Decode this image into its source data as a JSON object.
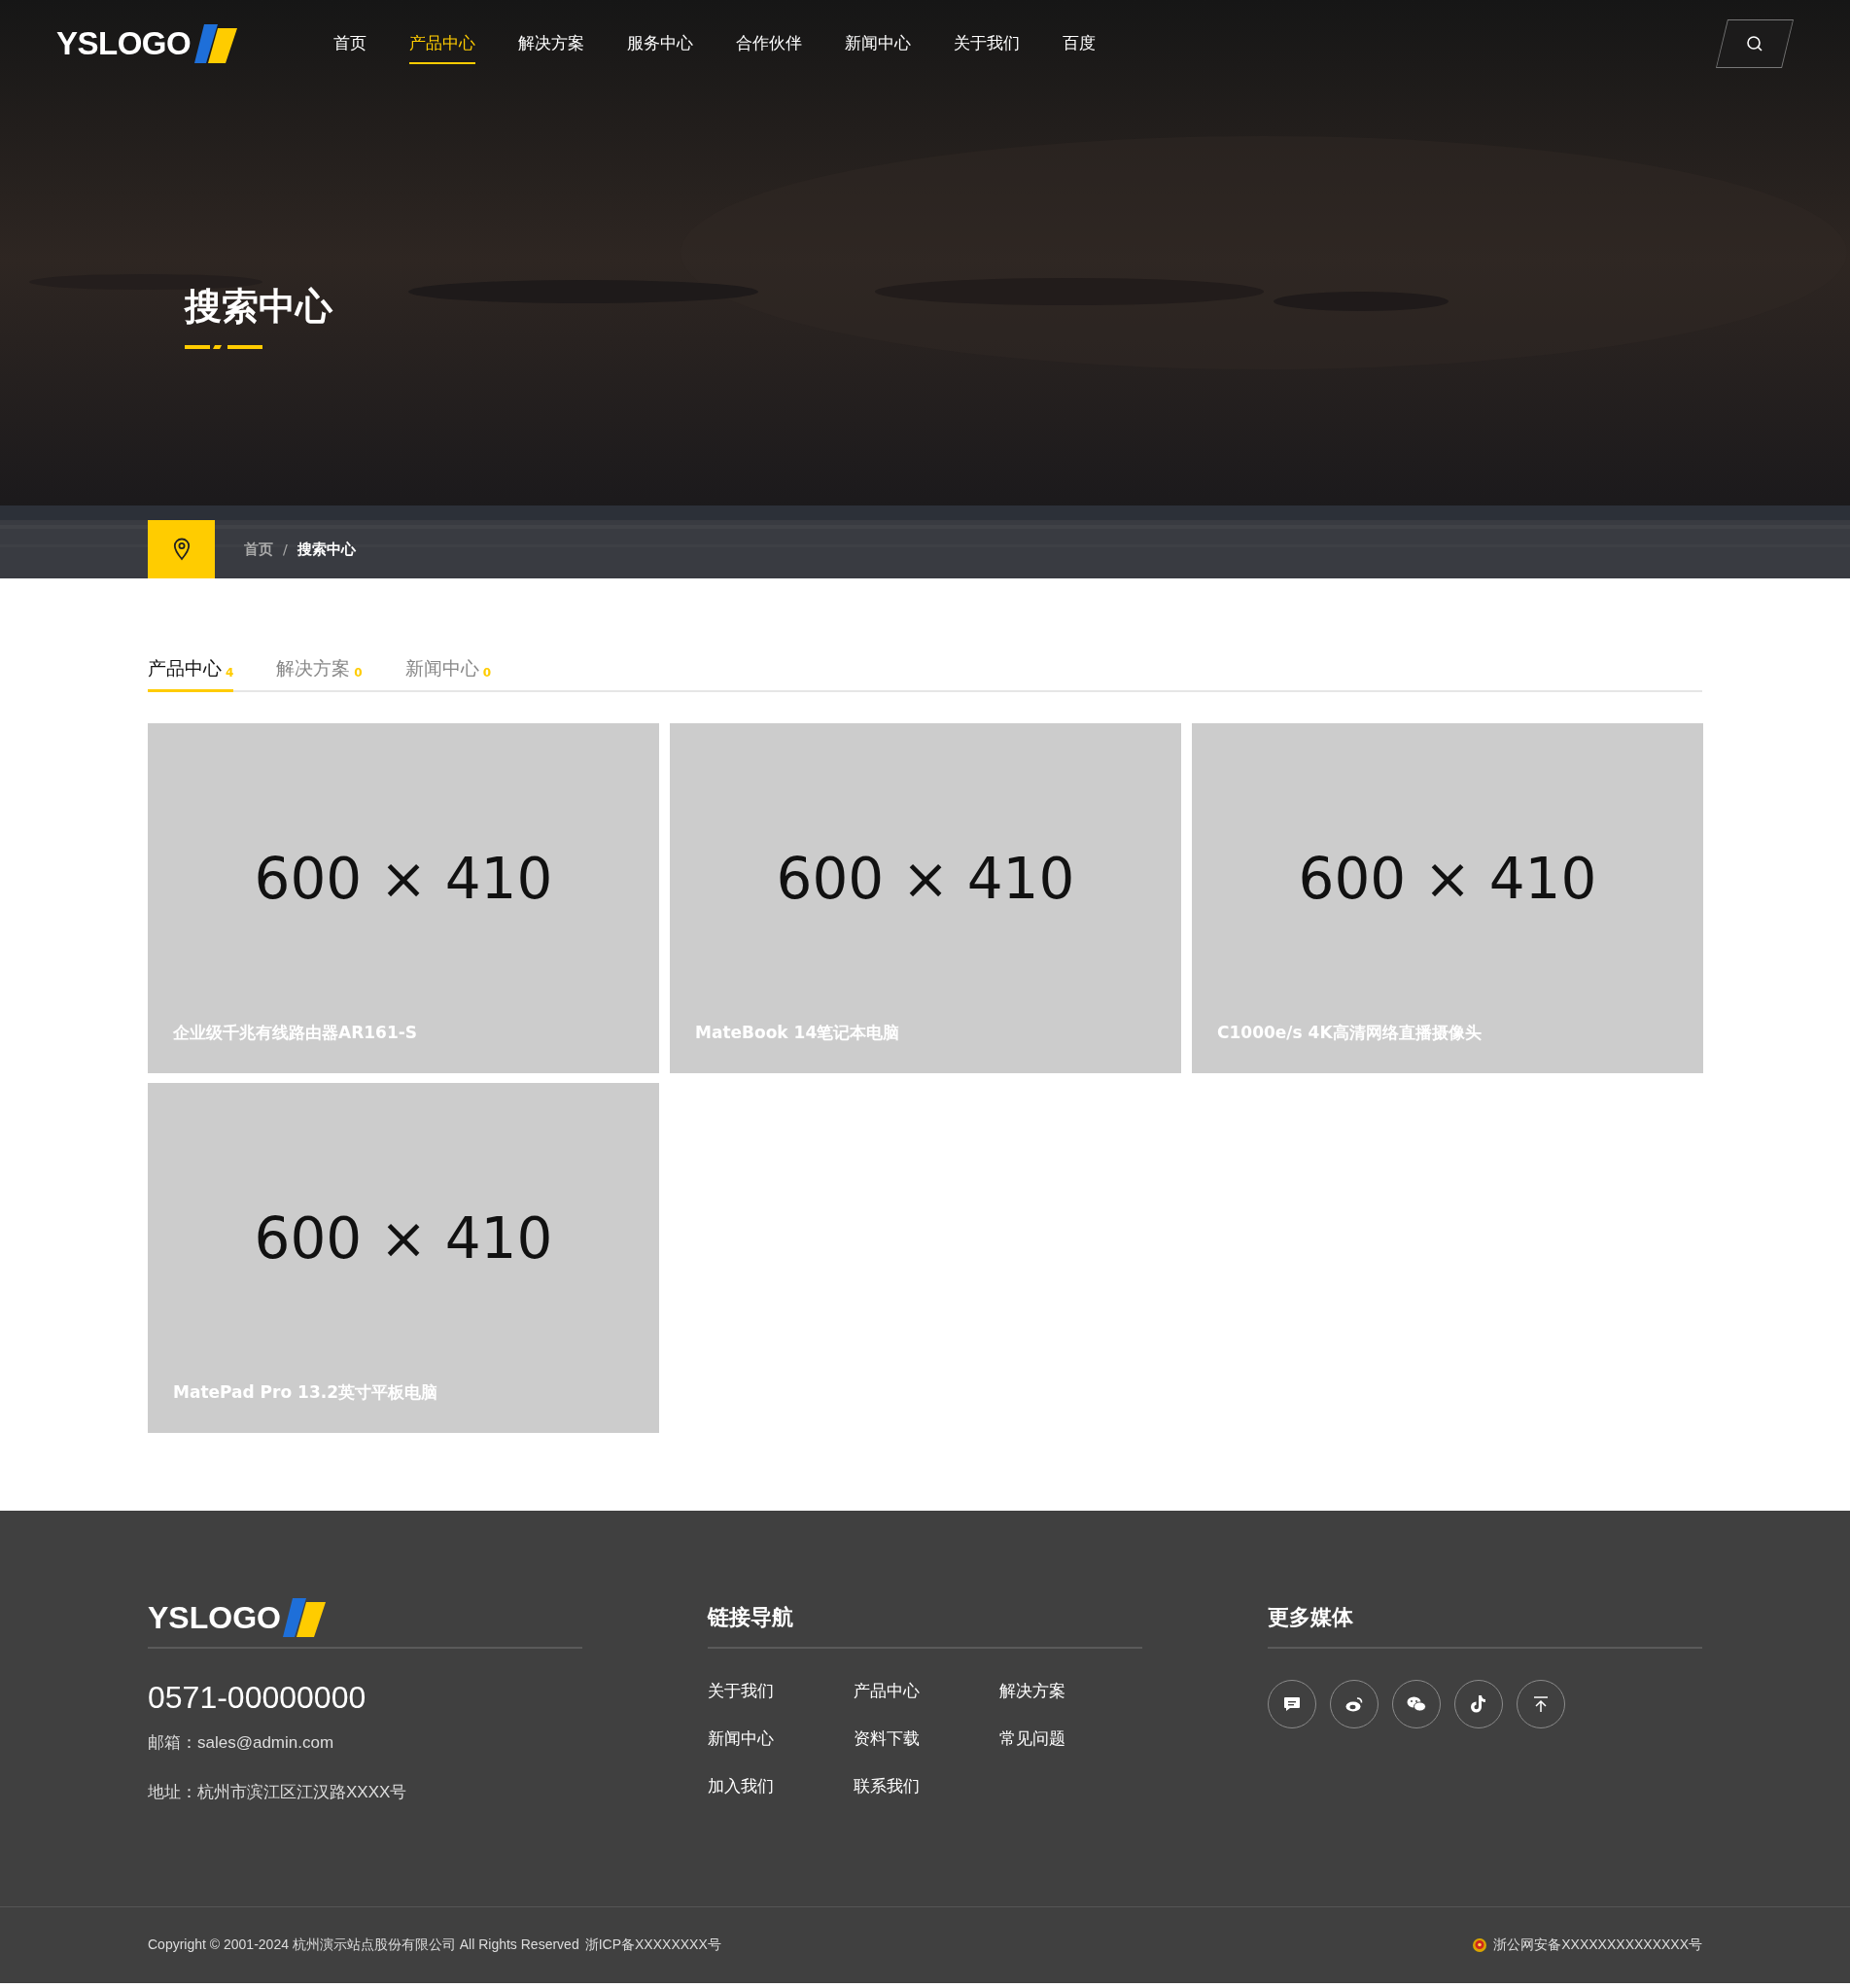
{
  "header": {
    "logo": "YSLOGO",
    "nav": [
      {
        "label": "首页",
        "selected": false
      },
      {
        "label": "产品中心",
        "selected": true
      },
      {
        "label": "解决方案",
        "selected": false
      },
      {
        "label": "服务中心",
        "selected": false
      },
      {
        "label": "合作伙伴",
        "selected": false
      },
      {
        "label": "新闻中心",
        "selected": false
      },
      {
        "label": "关于我们",
        "selected": false
      },
      {
        "label": "百度",
        "selected": false
      }
    ]
  },
  "banner": {
    "title": "搜索中心",
    "breadcrumb": [
      {
        "label": "首页",
        "current": false
      },
      {
        "label": "搜索中心",
        "current": true
      }
    ],
    "separator": "/"
  },
  "tabs": [
    {
      "label": "产品中心",
      "count": "4",
      "selected": true
    },
    {
      "label": "解决方案",
      "count": "0",
      "selected": false
    },
    {
      "label": "新闻中心",
      "count": "0",
      "selected": false
    }
  ],
  "products": [
    {
      "image_label": "600 × 410",
      "title": "企业级千兆有线路由器AR161-S"
    },
    {
      "image_label": "600 × 410",
      "title": "MateBook 14笔记本电脑"
    },
    {
      "image_label": "600 × 410",
      "title": "C1000e/s 4K高清网络直播摄像头"
    },
    {
      "image_label": "600 × 410",
      "title": "MatePad Pro 13.2英寸平板电脑"
    }
  ],
  "footer": {
    "logo": "YSLOGO",
    "phone": "0571-00000000",
    "email": "邮箱：sales@admin.com",
    "address": "地址：杭州市滨江区江汉路XXXX号",
    "links_title": "链接导航",
    "links": [
      "关于我们",
      "产品中心",
      "解决方案",
      "新闻中心",
      "资料下载",
      "常见问题",
      "加入我们",
      "联系我们"
    ],
    "media_title": "更多媒体",
    "media": [
      {
        "kind": "message"
      },
      {
        "kind": "weibo"
      },
      {
        "kind": "wechat"
      },
      {
        "kind": "tiktok"
      },
      {
        "kind": "top"
      }
    ],
    "copyright": "Copyright © 2001-2024 杭州演示站点股份有限公司 All Rights Reserved",
    "icp": "浙ICP备XXXXXXXX号",
    "police": "浙公网安备XXXXXXXXXXXXXX号"
  }
}
